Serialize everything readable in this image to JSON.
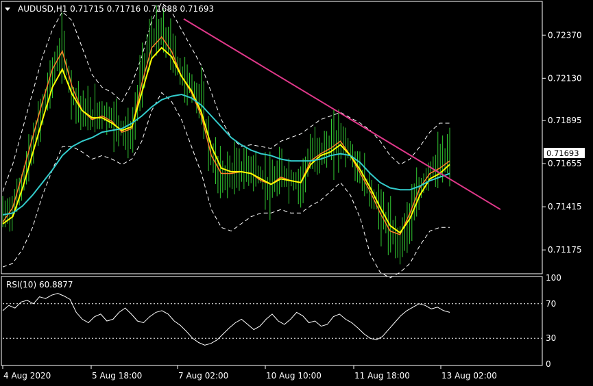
{
  "symbol_header": "AUDUSD,H1  0.71715 0.71716 0.71688 0.71693",
  "current_price_label": "0.71693",
  "colors": {
    "background": "#000000",
    "grid_border": "#ffffff",
    "candles": "#33cc33",
    "ma_fast": "#ff7f27",
    "ma_mid": "#ffff00",
    "ma_slow": "#33cccc",
    "envelope": "#ffffff",
    "trendline": "#e0388a",
    "rsi_line": "#ffffff",
    "price_box": "#ffffff"
  },
  "chart_data": [
    {
      "type": "candlestick",
      "title": "AUDUSD,H1  0.71715 0.71716 0.71688 0.71693",
      "ylim": [
        0.7105,
        0.7255
      ],
      "y_ticks": [
        "0.72370",
        "0.72130",
        "0.71895",
        "0.71655",
        "0.71415",
        "0.71175"
      ],
      "y_tick_values": [
        0.7237,
        0.7213,
        0.71895,
        0.71655,
        0.71415,
        0.71175
      ],
      "x_ticks": [
        "4 Aug 2020",
        "5 Aug 18:00",
        "7 Aug 02:00",
        "10 Aug 10:00",
        "11 Aug 18:00",
        "13 Aug 02:00"
      ],
      "price_path": [
        0.7137,
        0.714,
        0.7155,
        0.7175,
        0.7195,
        0.7215,
        0.723,
        0.7205,
        0.7195,
        0.7192,
        0.7194,
        0.719,
        0.7185,
        0.718,
        0.7215,
        0.7235,
        0.7238,
        0.723,
        0.7215,
        0.7208,
        0.72,
        0.717,
        0.7158,
        0.716,
        0.7162,
        0.7163,
        0.7158,
        0.7152,
        0.716,
        0.7157,
        0.7154,
        0.717,
        0.7172,
        0.7175,
        0.718,
        0.7172,
        0.716,
        0.715,
        0.714,
        0.7128,
        0.7122,
        0.7135,
        0.715,
        0.7162,
        0.7165,
        0.717
      ],
      "series": [
        {
          "kind": "ma_fast",
          "values": [
            0.7133,
            0.7141,
            0.716,
            0.718,
            0.72,
            0.7218,
            0.7228,
            0.7208,
            0.7195,
            0.719,
            0.7192,
            0.7189,
            0.7183,
            0.7185,
            0.721,
            0.723,
            0.7236,
            0.7228,
            0.7214,
            0.7205,
            0.7192,
            0.717,
            0.716,
            0.716,
            0.7161,
            0.716,
            0.7156,
            0.7154,
            0.7158,
            0.7156,
            0.7155,
            0.7167,
            0.7171,
            0.7174,
            0.7178,
            0.717,
            0.716,
            0.715,
            0.7138,
            0.7128,
            0.7126,
            0.7138,
            0.7152,
            0.716,
            0.7163,
            0.7167
          ]
        },
        {
          "kind": "ma_mid",
          "values": [
            0.7132,
            0.7136,
            0.7152,
            0.7171,
            0.719,
            0.7208,
            0.7218,
            0.7204,
            0.7195,
            0.7191,
            0.7191,
            0.7188,
            0.7184,
            0.7186,
            0.7205,
            0.7224,
            0.723,
            0.7225,
            0.7214,
            0.7206,
            0.7194,
            0.7175,
            0.7163,
            0.7161,
            0.7161,
            0.716,
            0.7157,
            0.7154,
            0.7157,
            0.7156,
            0.7155,
            0.7165,
            0.717,
            0.7172,
            0.7176,
            0.717,
            0.7162,
            0.7152,
            0.7141,
            0.7131,
            0.7127,
            0.7135,
            0.7148,
            0.7157,
            0.716,
            0.7165
          ]
        },
        {
          "kind": "ma_slow",
          "values": [
            0.7137,
            0.7138,
            0.7142,
            0.7148,
            0.7155,
            0.7162,
            0.717,
            0.7175,
            0.7178,
            0.718,
            0.7183,
            0.7184,
            0.7185,
            0.7188,
            0.7192,
            0.7197,
            0.7201,
            0.7203,
            0.7204,
            0.7202,
            0.7198,
            0.7192,
            0.7186,
            0.718,
            0.7176,
            0.7173,
            0.7171,
            0.717,
            0.7168,
            0.7167,
            0.7167,
            0.7167,
            0.7168,
            0.717,
            0.7171,
            0.717,
            0.7166,
            0.716,
            0.7155,
            0.7152,
            0.7151,
            0.7151,
            0.7153,
            0.7156,
            0.7158,
            0.716
          ]
        },
        {
          "kind": "envelope_upper",
          "values": [
            0.715,
            0.7165,
            0.7185,
            0.7205,
            0.7225,
            0.724,
            0.725,
            0.7245,
            0.723,
            0.7215,
            0.7208,
            0.7205,
            0.72,
            0.721,
            0.7225,
            0.7245,
            0.7255,
            0.725,
            0.724,
            0.723,
            0.722,
            0.7205,
            0.719,
            0.718,
            0.7175,
            0.7176,
            0.7175,
            0.7174,
            0.7178,
            0.718,
            0.7182,
            0.7186,
            0.719,
            0.7192,
            0.7194,
            0.7191,
            0.7188,
            0.7184,
            0.7178,
            0.717,
            0.7165,
            0.7168,
            0.7175,
            0.7183,
            0.7188,
            0.7188
          ]
        },
        {
          "kind": "envelope_lower",
          "values": [
            0.7108,
            0.711,
            0.7118,
            0.713,
            0.7148,
            0.7162,
            0.7175,
            0.7175,
            0.7172,
            0.7168,
            0.717,
            0.7168,
            0.7165,
            0.7168,
            0.7178,
            0.7195,
            0.7205,
            0.72,
            0.719,
            0.7175,
            0.716,
            0.714,
            0.713,
            0.7128,
            0.7132,
            0.7136,
            0.7138,
            0.7138,
            0.714,
            0.7138,
            0.7138,
            0.7142,
            0.7145,
            0.715,
            0.7155,
            0.7148,
            0.7135,
            0.7115,
            0.7105,
            0.7102,
            0.7105,
            0.711,
            0.712,
            0.7128,
            0.713,
            0.713
          ]
        }
      ],
      "trendline": {
        "from": 0.7246,
        "to": 0.714
      }
    },
    {
      "type": "line",
      "title": "RSI(10) 60.8877",
      "ylim": [
        0,
        100
      ],
      "y_ticks": [
        "100",
        "70",
        "30",
        "0"
      ],
      "y_tick_values": [
        100,
        70,
        30,
        0
      ],
      "levels": [
        70,
        30
      ],
      "values": [
        62,
        68,
        65,
        72,
        74,
        70,
        78,
        76,
        80,
        82,
        79,
        75,
        60,
        52,
        48,
        55,
        58,
        50,
        52,
        60,
        65,
        58,
        50,
        48,
        55,
        60,
        62,
        58,
        50,
        45,
        38,
        30,
        25,
        22,
        24,
        28,
        35,
        42,
        48,
        52,
        46,
        40,
        44,
        52,
        58,
        50,
        46,
        52,
        60,
        56,
        48,
        50,
        44,
        46,
        55,
        58,
        52,
        48,
        42,
        35,
        30,
        28,
        32,
        40,
        48,
        56,
        62,
        66,
        70,
        68,
        64,
        66,
        62,
        60
      ]
    }
  ]
}
